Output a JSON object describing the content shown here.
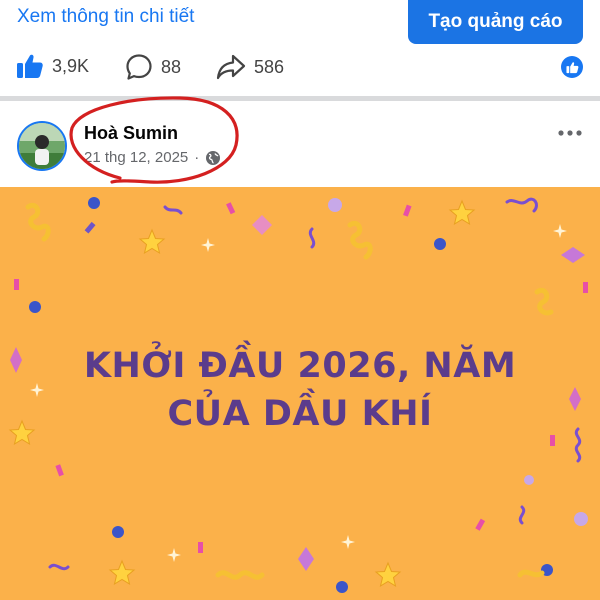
{
  "ad": {
    "details_link": "Xem thông tin chi tiết",
    "create_ad_button": "Tạo quảng cáo"
  },
  "stats": {
    "likes": "3,9K",
    "comments": "88",
    "shares": "586"
  },
  "post": {
    "author": "Hoà Sumin",
    "date": "21 thg 12, 2025",
    "separator": "·",
    "privacy_icon": "globe-icon",
    "headline_line1": "KHỞI ĐẦU 2026, NĂM",
    "headline_line2": "CỦA DẦU KHÍ"
  },
  "colors": {
    "fb_blue": "#1877f2",
    "image_bg": "#fbb14a",
    "headline": "#5b3c8c",
    "annotation_red": "#d42020"
  }
}
